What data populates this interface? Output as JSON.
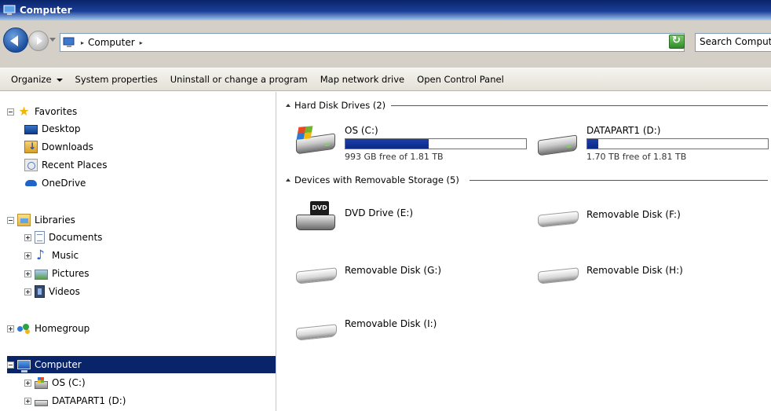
{
  "window": {
    "title": "Computer"
  },
  "address": {
    "crumbs": [
      "Computer"
    ],
    "search_placeholder": "Search Comput"
  },
  "toolbar": {
    "organize": "Organize",
    "system_properties": "System properties",
    "uninstall": "Uninstall or change a program",
    "map_network": "Map network drive",
    "open_control_panel": "Open Control Panel"
  },
  "nav": {
    "favorites": {
      "label": "Favorites",
      "items": [
        "Desktop",
        "Downloads",
        "Recent Places",
        "OneDrive"
      ]
    },
    "libraries": {
      "label": "Libraries",
      "items": [
        "Documents",
        "Music",
        "Pictures",
        "Videos"
      ]
    },
    "homegroup": "Homegroup",
    "computer": {
      "label": "Computer",
      "items": [
        "OS (C:)",
        "DATAPART1 (D:)"
      ]
    }
  },
  "content": {
    "hard_disks": {
      "header": "Hard Disk Drives (2)",
      "drives": [
        {
          "name": "OS (C:)",
          "free_text": "993 GB free of 1.81 TB",
          "used_fraction": 0.46
        },
        {
          "name": "DATAPART1 (D:)",
          "free_text": "1.70 TB free of 1.81 TB",
          "used_fraction": 0.06
        }
      ]
    },
    "removable": {
      "header": "Devices with Removable Storage (5)",
      "devices": [
        "DVD Drive (E:)",
        "Removable Disk (F:)",
        "Removable Disk (G:)",
        "Removable Disk (H:)",
        "Removable Disk (I:)"
      ]
    }
  },
  "colors": {
    "accent": "#0a246a",
    "bar_fill": "#1a3faa"
  }
}
